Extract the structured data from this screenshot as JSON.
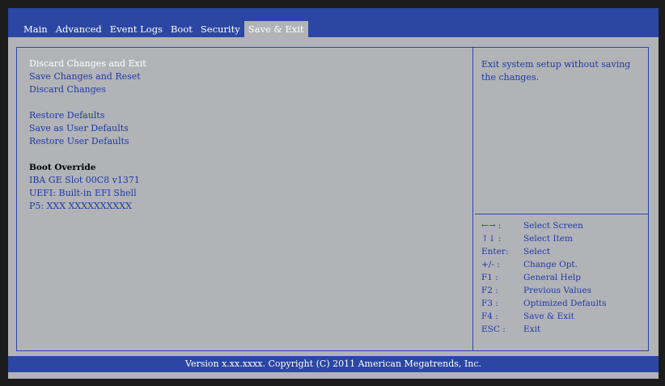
{
  "tabs": [
    "Main",
    "Advanced",
    "Event Logs",
    "Boot",
    "Security",
    "Save & Exit"
  ],
  "active_tab": "Save & Exit",
  "menu": {
    "items": [
      "Discard Changes and Exit",
      "Save Changes and Reset",
      "Discard Changes",
      "Restore Defaults",
      "Save as User Defaults",
      "Restore User Defaults",
      "Boot Override",
      "IBA GE Slot 00C8 v1371",
      "UEFI: Built-in EFI Shell",
      "P5: XXX XXXXXXXXXX"
    ],
    "selected": "Discard Changes and Exit"
  },
  "help": {
    "description": "Exit system setup without saving the changes."
  },
  "keys": [
    {
      "key": "←→ :",
      "action": "Select Screen"
    },
    {
      "key": "↑↓ :",
      "action": "Select Item"
    },
    {
      "key": "Enter:",
      "action": "Select"
    },
    {
      "key": "+/- :",
      "action": "Change Opt."
    },
    {
      "key": "F1 :",
      "action": "General Help"
    },
    {
      "key": "F2 :",
      "action": "Previous Values"
    },
    {
      "key": "F3 :",
      "action": "Optimized Defaults"
    },
    {
      "key": "F4 :",
      "action": "Save & Exit"
    },
    {
      "key": "ESC :",
      "action": "Exit"
    }
  ],
  "footer": "Version x.xx.xxxx. Copyright (C) 2011 American Megatrends, Inc.",
  "colors": {
    "bar_blue": "#2b47a3",
    "panel_gray": "#b2b3b7",
    "text_blue": "#1d3aa6",
    "frame": "#1c1c1c"
  }
}
